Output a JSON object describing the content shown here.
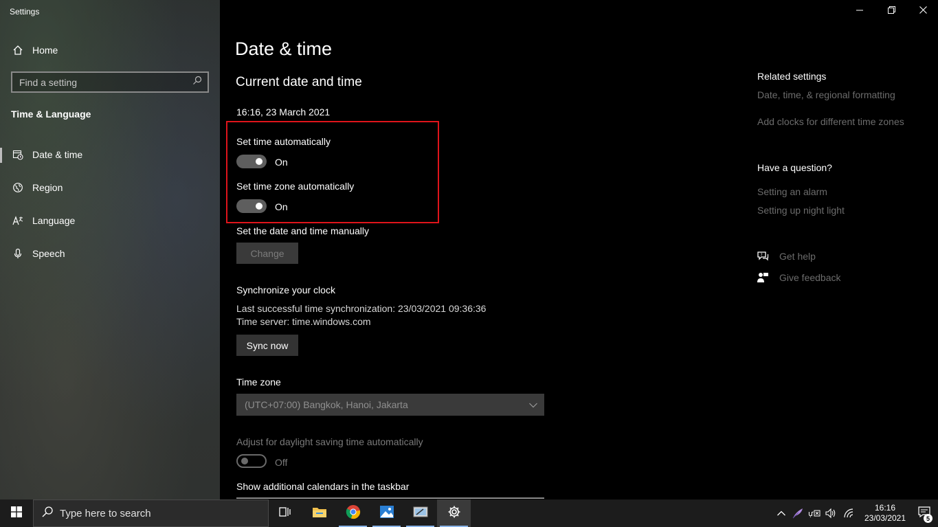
{
  "window": {
    "title": "Settings"
  },
  "sidebar": {
    "home_label": "Home",
    "search_placeholder": "Find a setting",
    "section": "Time & Language",
    "items": [
      {
        "label": "Date & time",
        "icon": "calendar-clock-icon",
        "active": true
      },
      {
        "label": "Region",
        "icon": "globe-icon"
      },
      {
        "label": "Language",
        "icon": "language-icon"
      },
      {
        "label": "Speech",
        "icon": "microphone-icon"
      }
    ]
  },
  "main": {
    "title": "Date & time",
    "subtitle": "Current date and time",
    "current_datetime": "16:16, 23 March 2021",
    "set_time_auto": {
      "label": "Set time automatically",
      "state": "On"
    },
    "set_timezone_auto": {
      "label": "Set time zone automatically",
      "state": "On"
    },
    "manual": {
      "label": "Set the date and time manually",
      "button": "Change"
    },
    "sync": {
      "heading": "Synchronize your clock",
      "last_sync": "Last successful time synchronization: 23/03/2021 09:36:36",
      "server": "Time server: time.windows.com",
      "button": "Sync now"
    },
    "timezone": {
      "label": "Time zone",
      "value": "(UTC+07:00) Bangkok, Hanoi, Jakarta"
    },
    "daylight": {
      "label": "Adjust for daylight saving time automatically",
      "state": "Off"
    },
    "calendars_label": "Show additional calendars in the taskbar"
  },
  "related": {
    "heading": "Related settings",
    "links": [
      "Date, time, & regional formatting",
      "Add clocks for different time zones"
    ],
    "question_heading": "Have a question?",
    "question_links": [
      "Setting an alarm",
      "Setting up night light"
    ],
    "help": "Get help",
    "feedback": "Give feedback"
  },
  "taskbar": {
    "search_placeholder": "Type here to search",
    "time": "16:16",
    "date": "23/03/2021",
    "notification_count": "5"
  },
  "colors": {
    "highlight": "#e0141b",
    "background": "#000000"
  }
}
